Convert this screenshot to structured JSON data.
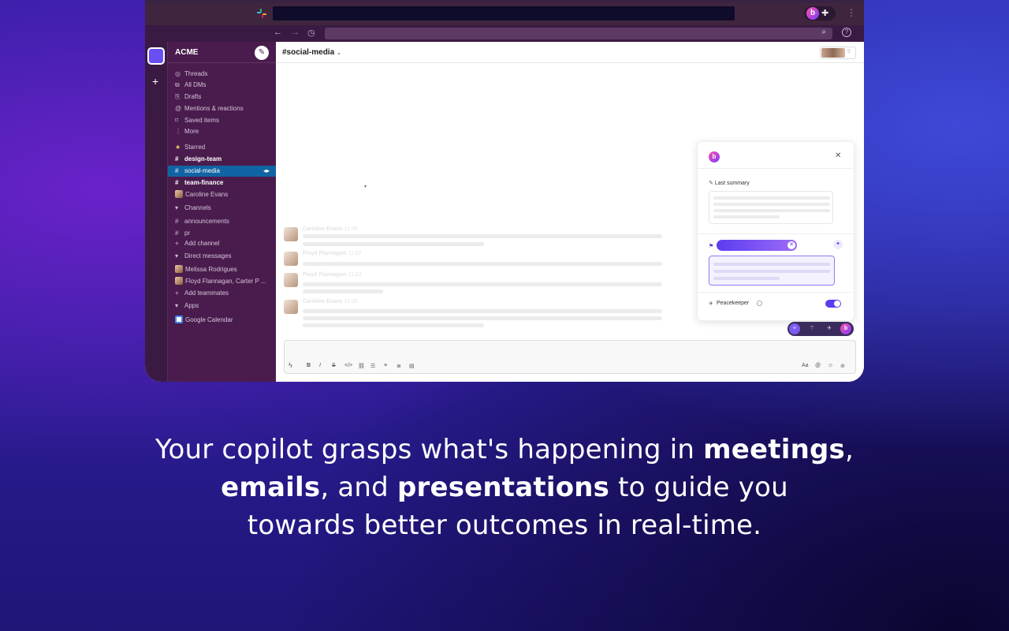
{
  "workspace": {
    "name": "ACME"
  },
  "sidebar": {
    "nav": [
      {
        "icon": "threads-icon",
        "glyph": "◎",
        "label": "Threads"
      },
      {
        "icon": "dms-icon",
        "glyph": "⧉",
        "label": "All DMs"
      },
      {
        "icon": "drafts-icon",
        "glyph": "⎘",
        "label": "Drafts"
      },
      {
        "icon": "mentions-icon",
        "glyph": "@",
        "label": "Mentions & reactions"
      },
      {
        "icon": "bookmark-icon",
        "glyph": "⌑",
        "label": "Saved items"
      },
      {
        "icon": "more-icon",
        "glyph": "⋮",
        "label": "More"
      }
    ],
    "starred_label": "Starred",
    "starred": [
      {
        "label": "design-team",
        "bold": true
      },
      {
        "label": "social-media",
        "active": true
      },
      {
        "label": "team-finance",
        "bold": true
      }
    ],
    "starred_dm": "Caroline Evans",
    "channels_label": "Channels",
    "channels": [
      "announcements",
      "pr"
    ],
    "add_channel": "Add channel",
    "dms_label": "Direct messages",
    "dms": [
      "Melissa Rodrigues",
      "Floyd Flannagan, Carter P ..."
    ],
    "add_teammates": "Add teammates",
    "apps_label": "Apps",
    "apps": [
      "Google Calendar"
    ]
  },
  "channel": {
    "title": "#social-media",
    "member_count": "5"
  },
  "messages": [
    {
      "author": "Caroline Evans",
      "time": "11:00"
    },
    {
      "author": "Floyd Flannagan",
      "time": "11:02"
    },
    {
      "author": "Floyd Flannagan",
      "time": "11:03"
    },
    {
      "author": "Caroline Evans",
      "time": "11:05"
    }
  ],
  "copilot": {
    "logo": "b",
    "summary_label": "Last summary",
    "peacekeeper_label": "Peacekeeper",
    "peacekeeper_on": true
  },
  "extension": {
    "logo": "b"
  },
  "caption": {
    "line1_pre": "Your copilot grasps what's happening in ",
    "line1_bold": "meetings",
    "line1_post": ",",
    "line2_bold1": "emails",
    "line2_mid": ", and ",
    "line2_bold2": "presentations",
    "line2_post": " to guide you",
    "line3": "towards better outcomes in real-time."
  },
  "colors": {
    "accent": "#5b3cf0",
    "sidebar_bg": "#4a1c4d",
    "active_channel": "#1164a3"
  }
}
